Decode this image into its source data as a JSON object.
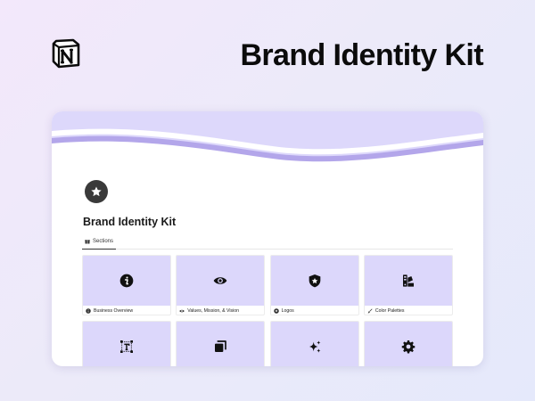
{
  "hero": {
    "title": "Brand Identity Kit"
  },
  "page": {
    "title": "Brand Identity Kit",
    "icon": "star-icon"
  },
  "tabs": [
    {
      "label": "Sections",
      "icon": "gift-icon"
    }
  ],
  "gallery": [
    {
      "label": "Business Overview",
      "icon": "info-icon"
    },
    {
      "label": "Values, Mission, & Vision",
      "icon": "eye-icon"
    },
    {
      "label": "Logos",
      "icon": "shield-star-icon"
    },
    {
      "label": "Color Palettes",
      "icon": "color-swatch-icon"
    },
    {
      "label": "",
      "icon": "text-box-icon"
    },
    {
      "label": "",
      "icon": "layers-icon"
    },
    {
      "label": "",
      "icon": "sparkles-icon"
    },
    {
      "label": "",
      "icon": "gear-icon"
    }
  ],
  "colors": {
    "banner_fill": "#ddd8fb",
    "banner_wave": "#b3a6ea",
    "tile_cover": "#dcd7fb"
  }
}
